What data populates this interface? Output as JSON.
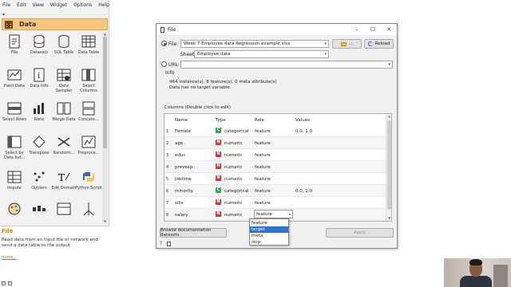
{
  "canvas": {
    "menu": [
      "File",
      "Edit",
      "View",
      "Widget",
      "Options",
      "Help"
    ],
    "category": {
      "title": "Data",
      "toggle": "▾"
    },
    "widgets": [
      {
        "label": "File",
        "icon": "file-icon"
      },
      {
        "label": "Datasets",
        "icon": "datasets-icon"
      },
      {
        "label": "SQL Table",
        "icon": "sql-table-icon"
      },
      {
        "label": "Data Table",
        "icon": "data-table-icon"
      },
      {
        "label": "Paint Data",
        "icon": "paint-data-icon"
      },
      {
        "label": "Data Info",
        "icon": "data-info-icon"
      },
      {
        "label": "Data Sampler",
        "icon": "data-sampler-icon"
      },
      {
        "label": "Select Columns",
        "icon": "select-columns-icon"
      },
      {
        "label": "Select Rows",
        "icon": "select-rows-icon"
      },
      {
        "label": "Rank",
        "icon": "rank-icon"
      },
      {
        "label": "Merge Data",
        "icon": "merge-data-icon"
      },
      {
        "label": "Concate...",
        "icon": "concatenate-icon"
      },
      {
        "label": "Select by Data Ind...",
        "icon": "select-by-index-icon"
      },
      {
        "label": "Transpose",
        "icon": "transpose-icon"
      },
      {
        "label": "Randomi...",
        "icon": "randomize-icon"
      },
      {
        "label": "Preproce...",
        "icon": "preprocess-icon"
      },
      {
        "label": "Impute",
        "icon": "impute-icon"
      },
      {
        "label": "Outliers",
        "icon": "outliers-icon"
      },
      {
        "label": "Edit Domain",
        "icon": "edit-domain-icon"
      },
      {
        "label": "Python Script",
        "icon": "python-script-icon"
      },
      {
        "label": "",
        "icon": "palette-icon"
      },
      {
        "label": "",
        "icon": "purge-icon"
      },
      {
        "label": "",
        "icon": "create-class-icon"
      },
      {
        "label": "",
        "icon": "feature-constructor-icon"
      }
    ],
    "help": {
      "title": "File",
      "text": "Read data from an input file or network and send a data table to the output.",
      "more": "more..."
    }
  },
  "dialog": {
    "title": "File",
    "window_controls": [
      "–",
      "☐",
      "✕"
    ],
    "file_label": "File:",
    "file_value": "Week 7 Employee data Regression example.xlsx",
    "browse_label": "...",
    "reload_label": "Reload",
    "sheet_label": "Sheet",
    "sheet_value": "Employee data",
    "url_label": "URL:",
    "url_value": "",
    "info": {
      "title": "Info",
      "line1": "464 instance(s), 8 feature(s), 0 meta attribute(s)",
      "line2": "Data has no target variable."
    },
    "columns": {
      "title": "Columns (Double click to edit)",
      "headers": {
        "name": "Name",
        "type": "Type",
        "role": "Role",
        "values": "Values"
      },
      "rows": [
        {
          "num": "1",
          "name": "Female",
          "badge": "C",
          "type": "categorical",
          "role": "feature",
          "values": "0.0, 1.0"
        },
        {
          "num": "2",
          "name": "age",
          "badge": "N",
          "type": "numeric",
          "role": "feature",
          "values": ""
        },
        {
          "num": "3",
          "name": "educ",
          "badge": "N",
          "type": "numeric",
          "role": "feature",
          "values": ""
        },
        {
          "num": "4",
          "name": "prevexp",
          "badge": "N",
          "type": "numeric",
          "role": "feature",
          "values": ""
        },
        {
          "num": "5",
          "name": "jobtime",
          "badge": "N",
          "type": "numeric",
          "role": "feature",
          "values": ""
        },
        {
          "num": "6",
          "name": "minority",
          "badge": "C",
          "type": "categorical",
          "role": "feature",
          "values": "0.0, 1.0"
        },
        {
          "num": "7",
          "name": "sibs",
          "badge": "N",
          "type": "numeric",
          "role": "feature",
          "values": ""
        },
        {
          "num": "8",
          "name": "salary",
          "badge": "N",
          "type": "numeric",
          "role": "feature",
          "values": ""
        }
      ]
    },
    "role_options": [
      "feature",
      "target",
      "meta",
      "skip"
    ],
    "role_selected": "target",
    "browse_docs_label": "Browse documentation datasets",
    "apply_label": "Apply"
  },
  "colors": {
    "category_header": "#f7c67d",
    "categorical_badge": "#33a852",
    "numeric_badge": "#d93535",
    "selection": "#2b74d3"
  }
}
